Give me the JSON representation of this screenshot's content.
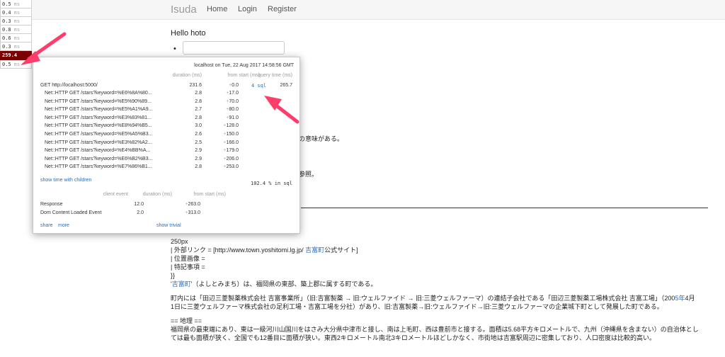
{
  "navbar": {
    "brand": "Isuda",
    "links": [
      "Home",
      "Login",
      "Register"
    ]
  },
  "profiler_badges": [
    {
      "value": "0.5",
      "unit": "ms"
    },
    {
      "value": "0.4",
      "unit": "ms"
    },
    {
      "value": "0.3",
      "unit": "ms"
    },
    {
      "value": "0.8",
      "unit": "ms"
    },
    {
      "value": "0.6",
      "unit": "ms"
    },
    {
      "value": "0.3",
      "unit": "ms"
    },
    {
      "value": "259.4",
      "unit": "ms"
    },
    {
      "value": "0.5",
      "unit": "ms"
    }
  ],
  "page": {
    "greeting": "Hello hoto",
    "bullet": "•",
    "fragment_1": "の意味がある。",
    "fragment_2": "参照。"
  },
  "profiler": {
    "header": "localhost on Tue, 22 Aug 2017 14:58:56 GMT",
    "columns": {
      "duration": "duration (ms)",
      "from_start": "from start (ms)",
      "query_time": "query time (ms)"
    },
    "root": {
      "label": "GET http://localhost:5000/",
      "duration": "231.6",
      "plus": "+",
      "start": "0.0",
      "sql": "4 sql",
      "query_time": "265.7"
    },
    "rows": [
      {
        "label": "Net::HTTP GET /stars?keyword=%E6%8A%80...",
        "duration": "2.8",
        "plus": "+",
        "start": "17.0"
      },
      {
        "label": "Net::HTTP GET /stars?keyword=%E5%90%89...",
        "duration": "2.8",
        "plus": "+",
        "start": "70.0"
      },
      {
        "label": "Net::HTTP GET /stars?keyword=%E5%A1%A9...",
        "duration": "2.7",
        "plus": "+",
        "start": "80.0"
      },
      {
        "label": "Net::HTTP GET /stars?keyword=%E3%83%81...",
        "duration": "2.8",
        "plus": "+",
        "start": "91.0"
      },
      {
        "label": "Net::HTTP GET /stars?keyword=%E8%94%B5...",
        "duration": "3.0",
        "plus": "+",
        "start": "128.0"
      },
      {
        "label": "Net::HTTP GET /stars?keyword=%E5%A5%B3...",
        "duration": "2.6",
        "plus": "+",
        "start": "150.0"
      },
      {
        "label": "Net::HTTP GET /stars?keyword=%E3%82%A2...",
        "duration": "2.5",
        "plus": "+",
        "start": "166.0"
      },
      {
        "label": "Net::HTTP GET /stars?keyword=%E4%BB%A...",
        "duration": "2.9",
        "plus": "+",
        "start": "179.0"
      },
      {
        "label": "Net::HTTP GET /stars?keyword=%E6%B2%B3...",
        "duration": "2.9",
        "plus": "+",
        "start": "206.0"
      },
      {
        "label": "Net::HTTP GET /stars?keyword=%E7%86%B1...",
        "duration": "2.8",
        "plus": "+",
        "start": "253.0"
      }
    ],
    "show_children": "show time with children",
    "sql_percent": "102.4 % in sql",
    "client_columns": {
      "event": "client event",
      "duration": "duration (ms)",
      "from_start": "from start (ms)"
    },
    "client_events": [
      {
        "label": "Response",
        "duration": "12.0",
        "plus": "+",
        "start": "263.0"
      },
      {
        "label": "Dom Content Loaded Event",
        "duration": "2.0",
        "plus": "+",
        "start": "313.0"
      }
    ],
    "share": "share",
    "more": "more",
    "show_trivial": "show trivial"
  },
  "content": {
    "line_1": "250px",
    "line_2a": "| 外部リンク = [http://www.town.yoshitomi.lg.jp/ ",
    "line_2b": "吉富町",
    "line_2c": "公式サイト]",
    "line_3": "| 位置画像 =",
    "line_4": "| 特記事項 =",
    "line_5": "}}",
    "line_6a": "'",
    "line_6b": "吉富町",
    "line_6c": "'（よしとみまち）は、福岡県の東部、築上郡に属する町である。",
    "para_1a": "町内には「田辺三菱製薬株式会社 吉富事業所」（旧:吉富製薬 → 旧:ウェルファイド → 旧:三菱ウェルファーマ）の連結子会社である「田辺三菱製薬工場株式会社 吉富工場」（200",
    "para_1b": "5年",
    "para_1c": "4月",
    "para_2": "1日に三菱ウェルファーマ株式会社の足利工場・吉富工場を分社）があり、旧:吉富製薬→旧:ウェルファイド→旧:三菱ウェルファーマの企業城下町として発展した町である。",
    "heading": "== 地理 ==",
    "para_3": "福岡県の最東端にあり、東は一級河川山国川をはさみ大分県中津市と接し、南は上毛町、西は豊前市と接する。面積は5.68平方キロメートルで、九州（沖縄県を含まない）の自治体とし",
    "para_4": "ては最も面積が狭く、全国でも12番目に面積が狭い。東西2キロメートル南北3キロメートルほどしかなく、市街地は吉富駅周辺に密集しており、人口密度は比較的高い。"
  },
  "colors": {
    "accent_badge": "#7b0000",
    "link": "#2a6ebb",
    "arrow": "#ff3d6a"
  }
}
